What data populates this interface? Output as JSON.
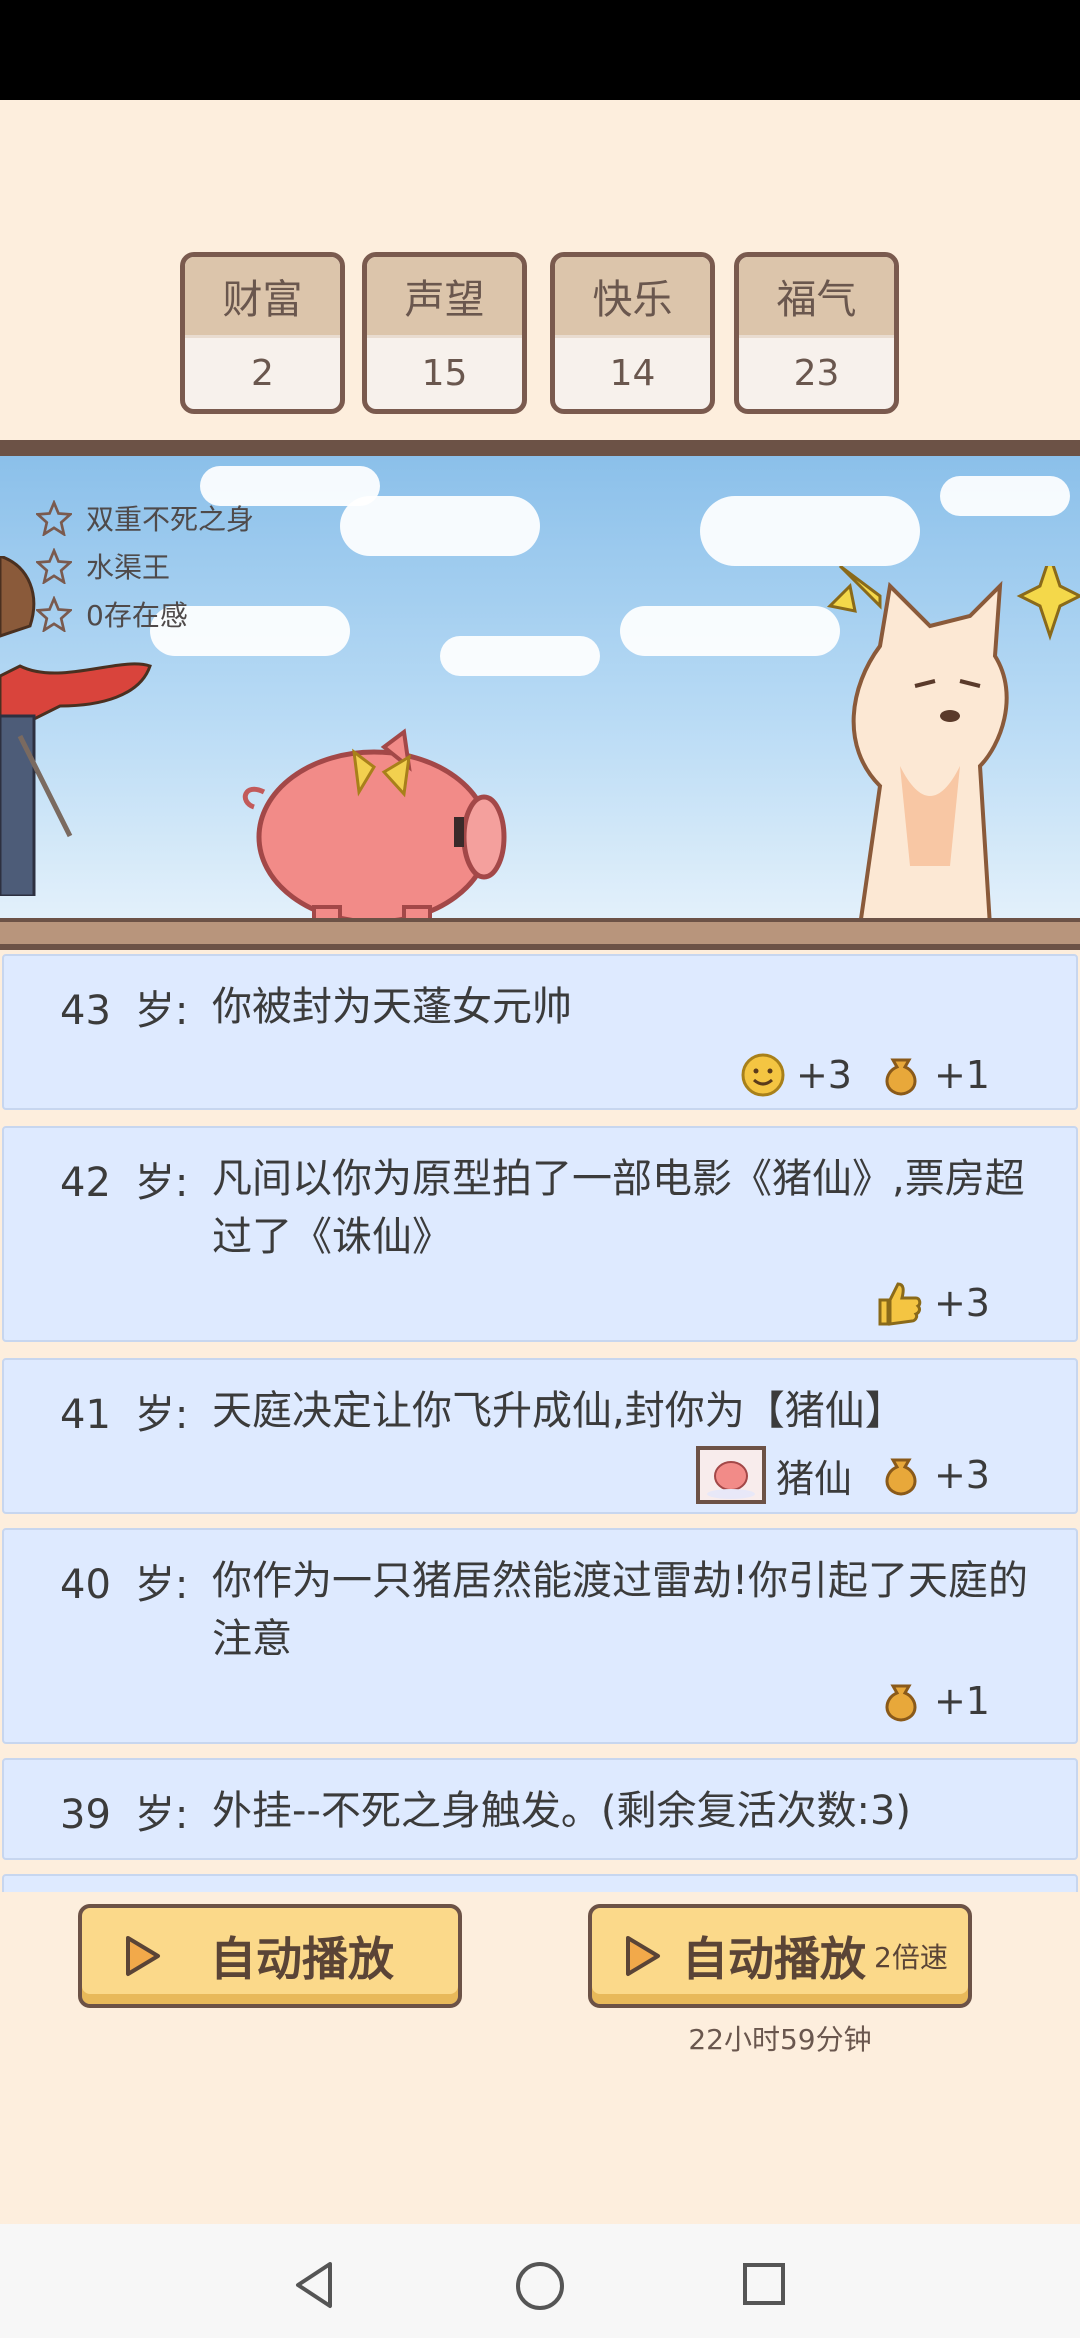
{
  "stats": [
    {
      "label": "财富",
      "value": "2"
    },
    {
      "label": "声望",
      "value": "15"
    },
    {
      "label": "快乐",
      "value": "14"
    },
    {
      "label": "福气",
      "value": "23"
    }
  ],
  "traits": [
    "双重不死之身",
    "水渠王",
    "0存在感"
  ],
  "events": [
    {
      "age": "43",
      "sui": "岁:",
      "text": "你被封为天蓬女元帅",
      "effects": [
        {
          "icon": "smile-icon",
          "value": "+3"
        },
        {
          "icon": "luck-bag-icon",
          "value": "+1"
        }
      ]
    },
    {
      "age": "42",
      "sui": "岁:",
      "text": "凡间以你为原型拍了一部电影《猪仙》,票房超过了《诛仙》",
      "effects": [
        {
          "icon": "thumbs-up-icon",
          "value": "+3"
        }
      ]
    },
    {
      "age": "41",
      "sui": "岁:",
      "text": "天庭决定让你飞升成仙,封你为【猪仙】",
      "effects": [
        {
          "icon": "pig-portrait-icon",
          "value": "猪仙"
        },
        {
          "icon": "luck-bag-icon",
          "value": "+3"
        }
      ]
    },
    {
      "age": "40",
      "sui": "岁:",
      "text": "你作为一只猪居然能渡过雷劫!你引起了天庭的注意",
      "effects": [
        {
          "icon": "luck-bag-icon",
          "value": "+1"
        }
      ]
    },
    {
      "age": "39",
      "sui": "岁:",
      "text": "外挂--不死之身触发。(剩余复活次数:3)",
      "effects": []
    }
  ],
  "buttons": {
    "autoplay_label": "自动播放",
    "autoplay2x_label": "自动播放",
    "speed_label": "2倍速",
    "timer": "22小时59分钟"
  },
  "colors": {
    "background": "#fdeedd",
    "event_bg": "#deeaff",
    "button": "#fbd98a",
    "border": "#6c5246"
  }
}
